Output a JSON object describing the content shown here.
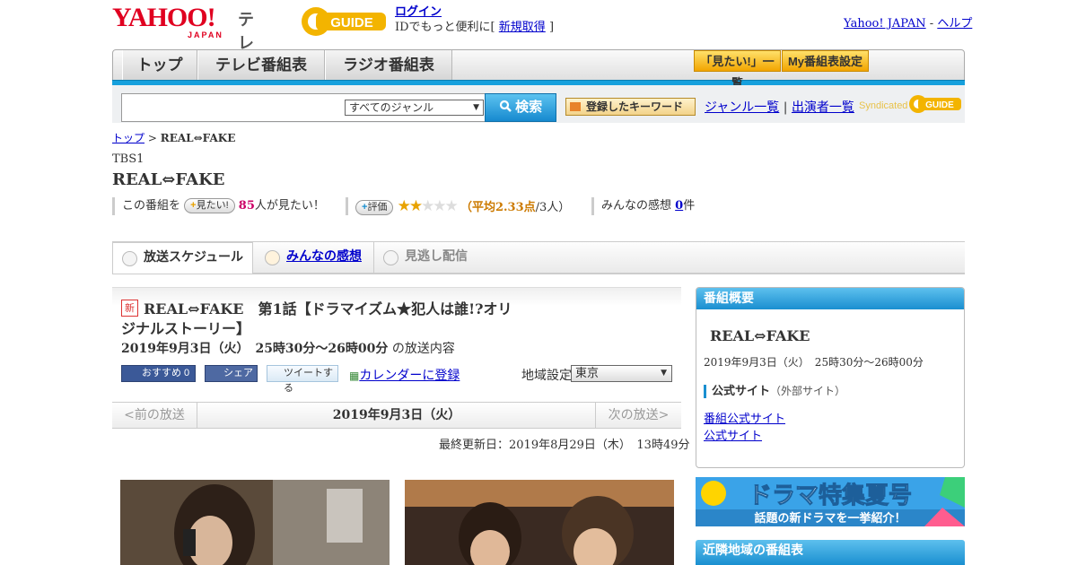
{
  "header": {
    "logo_text": "YAHOO!",
    "logo_sub": "JAPAN",
    "tv_label": "テレビ",
    "gguide_text": "GUIDE",
    "login_link": "ログイン",
    "id_text": "IDでもっと便利に[",
    "signup_link": "新規取得",
    "id_text_end": "]",
    "yahoo_japan_link": "Yahoo! JAPAN",
    "separator": "-",
    "help_link": "ヘルプ"
  },
  "nav": {
    "tabs": [
      "トップ",
      "テレビ番組表",
      "ラジオ番組表"
    ],
    "want_list_button": "「見たい!」一覧",
    "my_schedule_button": "My番組表設定"
  },
  "search": {
    "genre_selected": "すべてのジャンル",
    "search_button": "検索",
    "keyword_button": "登録したキーワード",
    "genre_list_link": "ジャンル一覧",
    "divider": "|",
    "cast_list_link": "出演者一覧",
    "syndicated": "Syndicated"
  },
  "breadcrumb": {
    "top": "トップ",
    "sep": ">",
    "current": "REAL⇔FAKE"
  },
  "program": {
    "station": "TBS1",
    "title": "REAL⇔FAKE",
    "want_prefix": "この番組を",
    "want_button": "見たい!",
    "want_count": "85",
    "want_suffix": "人が見たい！",
    "rate_button": "評価",
    "stars_on": "★★",
    "stars_off": "★★★",
    "avg_open": "（",
    "avg_label": "平均2.33点",
    "avg_tail": "/3人）",
    "impressions_label": "みんなの感想",
    "impressions_count": "0",
    "impressions_unit": "件"
  },
  "tabs": [
    {
      "label": "放送スケジュール"
    },
    {
      "label": "みんなの感想"
    },
    {
      "label": "見逃し配信"
    }
  ],
  "episode": {
    "new_badge": "新",
    "title": "REAL⇔FAKE　第1話【ドラマイズム★犯人は誰!?オリジナルストーリー】",
    "date": "2019年9月3日（火）　25時30分～26時00分",
    "date_suffix": "の放送内容",
    "fb_recommend": "おすすめ 0",
    "fb_share": "シェア",
    "tweet": "ツイートする",
    "calendar": "カレンダーに登録",
    "region_label": "地域設定",
    "region_value": "東京"
  },
  "pager": {
    "prev": "<前の放送",
    "current": "2019年9月3日（火）",
    "next": "次の放送>"
  },
  "updated": "最終更新日：2019年8月29日（木）　13時49分",
  "sidebar": {
    "overview_head": "番組概要",
    "title": "REAL⇔FAKE",
    "date": "2019年9月3日（火）　25時30分～26時00分",
    "official_head": "公式サイト",
    "official_note": "（外部サイト）",
    "link1": "番組公式サイト",
    "link2": "公式サイト",
    "banner_title": "ドラマ特集夏号",
    "banner_sub": "話題の新ドラマを一挙紹介！",
    "nearby_head": "近隣地域の番組表"
  },
  "colors": {
    "brand_red": "#e00020",
    "accent_blue": "#1a8fd0",
    "star": "#e8a200",
    "want_count": "#cc0066"
  }
}
